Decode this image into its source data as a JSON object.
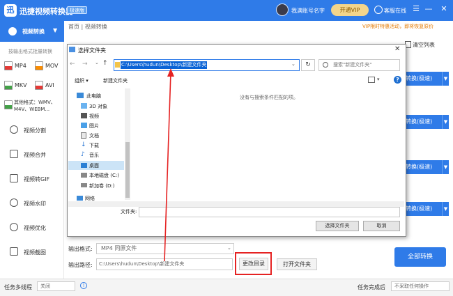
{
  "app": {
    "title": "迅捷视频转换器",
    "edition": "极速版",
    "username": "我满账号名字",
    "vip_label": "开通VIP",
    "service_label": "客服在线"
  },
  "window_controls": {
    "menu": "☰",
    "minimize": "—",
    "maximize": "☐",
    "close": "✕"
  },
  "sidebar": {
    "active": "视频转换",
    "format_hint": "按输出格式批量转换",
    "formats": [
      {
        "label": "MP4",
        "color": "#e53935"
      },
      {
        "label": "MOV",
        "color": "#fb8c00"
      },
      {
        "label": "MKV",
        "color": "#43a047"
      },
      {
        "label": "AVI",
        "color": "#e53935"
      }
    ],
    "other_formats": [
      "其他格式：WMV、",
      "M4V、WEBM..."
    ],
    "items": [
      "视频分割",
      "视频合并",
      "视频转GIF",
      "视频水印",
      "视频优化",
      "视频截图"
    ]
  },
  "main": {
    "breadcrumb": "首页 | 视频转换",
    "promo": "VIP限时特惠活动，即将恢复原价",
    "clear_list": "清空列表",
    "convert_buttons": [
      "转换(极速)",
      "转换(极速)",
      "转换(极速)",
      "转换(极速)"
    ],
    "output_format_label": "输出格式:",
    "output_format_value": "MP4  同原文件",
    "output_path_label": "输出路径:",
    "output_path_value": "C:\\Users\\hudun\\Desktop\\新建文件夹",
    "change_dir": "更改目录",
    "open_folder": "打开文件夹",
    "convert_all": "全部转换"
  },
  "statusbar": {
    "multithread_label": "任务多线程",
    "multithread_value": "关闭",
    "after_label": "任务完成后",
    "after_value": "不采取任何操作"
  },
  "dialog": {
    "title": "选择文件夹",
    "address": "C:\\Users\\hudun\\Desktop\\新建文件夹",
    "search_placeholder": "搜索\"新建文件夹\"",
    "organize": "组织 ▾",
    "new_folder": "新建文件夹",
    "empty_message": "没有与搜索条件匹配的项。",
    "tree": [
      "此电脑",
      "3D 对象",
      "视频",
      "图片",
      "文档",
      "下载",
      "音乐",
      "桌面",
      "本地磁盘 (C:)",
      "新加卷 (D:)",
      "网络"
    ],
    "filename_label": "文件夹:",
    "select_button": "选择文件夹",
    "cancel_button": "取消"
  }
}
